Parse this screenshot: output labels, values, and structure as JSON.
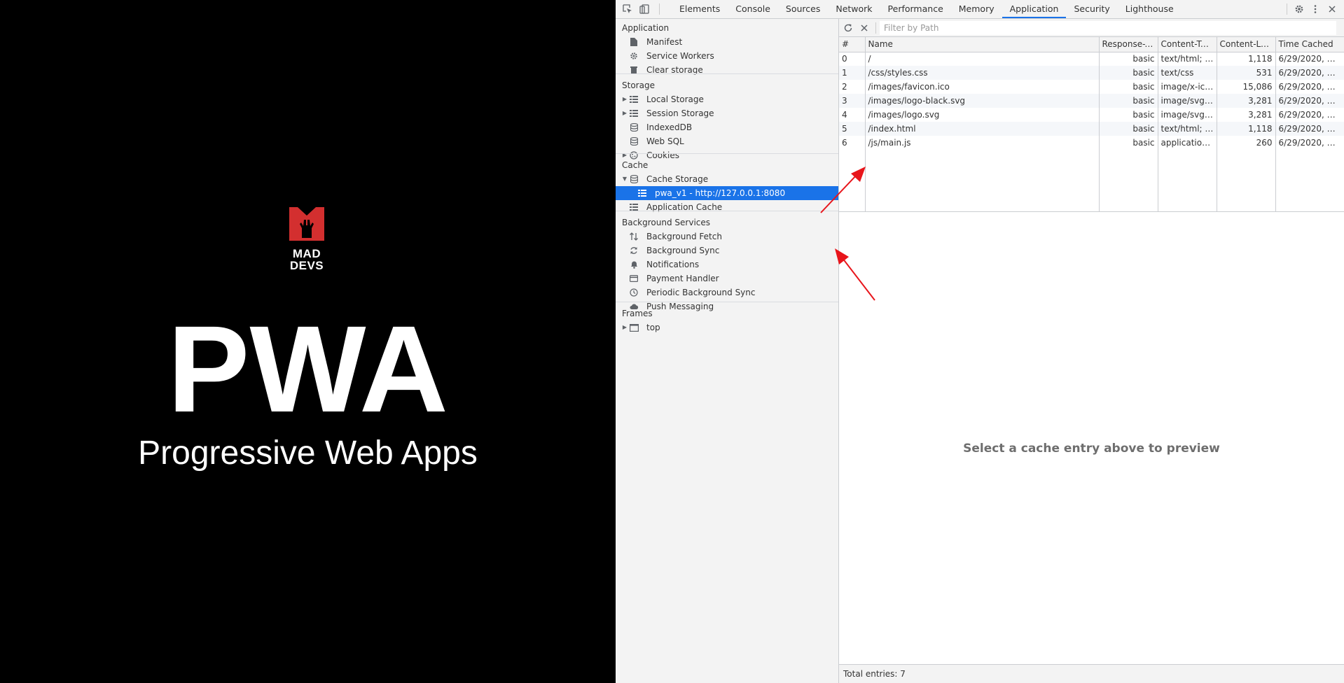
{
  "page": {
    "logo_line1": "MAD",
    "logo_line2": "DEVS",
    "logo_color": "#d32f2f",
    "title": "PWA",
    "subtitle": "Progressive Web Apps"
  },
  "devtools": {
    "toolbar_icons": [
      "inspect-element-icon",
      "device-toolbar-icon"
    ],
    "tabs": [
      {
        "label": "Elements"
      },
      {
        "label": "Console"
      },
      {
        "label": "Sources"
      },
      {
        "label": "Network"
      },
      {
        "label": "Performance"
      },
      {
        "label": "Memory"
      },
      {
        "label": "Application",
        "active": true
      },
      {
        "label": "Security"
      },
      {
        "label": "Lighthouse"
      }
    ],
    "right_icons": [
      "gear-icon",
      "more-vert-icon",
      "close-icon"
    ],
    "accent_color": "#1a73e8",
    "sidebar": {
      "application": {
        "title": "Application",
        "items": [
          {
            "label": "Manifest",
            "icon": "file-icon"
          },
          {
            "label": "Service Workers",
            "icon": "gear-icon"
          },
          {
            "label": "Clear storage",
            "icon": "trash-icon"
          }
        ]
      },
      "storage": {
        "title": "Storage",
        "items": [
          {
            "label": "Local Storage",
            "icon": "grid-icon",
            "expandable": true
          },
          {
            "label": "Session Storage",
            "icon": "grid-icon",
            "expandable": true
          },
          {
            "label": "IndexedDB",
            "icon": "database-icon"
          },
          {
            "label": "Web SQL",
            "icon": "database-icon"
          },
          {
            "label": "Cookies",
            "icon": "cookie-icon",
            "expandable": true
          }
        ]
      },
      "cache": {
        "title": "Cache",
        "items": [
          {
            "label": "Cache Storage",
            "icon": "database-icon",
            "expanded": true
          },
          {
            "label": "pwa_v1 - http://127.0.0.1:8080",
            "icon": "grid-icon",
            "selected": true
          },
          {
            "label": "Application Cache",
            "icon": "grid-icon"
          }
        ]
      },
      "background": {
        "title": "Background Services",
        "items": [
          {
            "label": "Background Fetch",
            "icon": "arrows-updown-icon"
          },
          {
            "label": "Background Sync",
            "icon": "sync-icon"
          },
          {
            "label": "Notifications",
            "icon": "bell-icon"
          },
          {
            "label": "Payment Handler",
            "icon": "card-icon"
          },
          {
            "label": "Periodic Background Sync",
            "icon": "clock-icon"
          },
          {
            "label": "Push Messaging",
            "icon": "cloud-icon"
          }
        ]
      },
      "frames": {
        "title": "Frames",
        "items": [
          {
            "label": "top",
            "icon": "frame-icon",
            "expandable": true
          }
        ]
      }
    },
    "main": {
      "filter_placeholder": "Filter by Path",
      "columns": [
        "#",
        "Name",
        "Response-T…",
        "Content-Type",
        "Content-Le…",
        "Time Cached"
      ],
      "rows": [
        [
          "0",
          "/",
          "basic",
          "text/html; …",
          "1,118",
          "6/29/2020, …"
        ],
        [
          "1",
          "/css/styles.css",
          "basic",
          "text/css",
          "531",
          "6/29/2020, …"
        ],
        [
          "2",
          "/images/favicon.ico",
          "basic",
          "image/x-icon",
          "15,086",
          "6/29/2020, …"
        ],
        [
          "3",
          "/images/logo-black.svg",
          "basic",
          "image/svg+…",
          "3,281",
          "6/29/2020, …"
        ],
        [
          "4",
          "/images/logo.svg",
          "basic",
          "image/svg+…",
          "3,281",
          "6/29/2020, …"
        ],
        [
          "5",
          "/index.html",
          "basic",
          "text/html; …",
          "1,118",
          "6/29/2020, …"
        ],
        [
          "6",
          "/js/main.js",
          "basic",
          "application…",
          "260",
          "6/29/2020, …"
        ]
      ],
      "preview_text": "Select a cache entry above to preview",
      "status": "Total entries: 7"
    },
    "annotation_arrow_color": "#e8151b"
  }
}
